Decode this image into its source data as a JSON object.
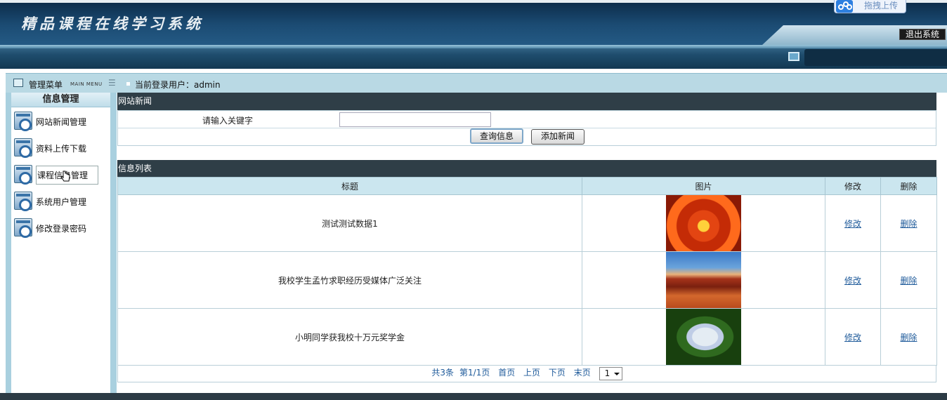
{
  "header": {
    "app_title": "精品课程在线学习系统",
    "upload_label": "拖拽上传",
    "logout_label": "退出系统"
  },
  "subbar": {
    "menu_title": "管理菜单",
    "menu_sub": "MAIN MENU",
    "user_label": "当前登录用户：",
    "user_name": "admin"
  },
  "sidebar": {
    "section": "信息管理",
    "items": [
      {
        "label": "网站新闻管理"
      },
      {
        "label": "资料上传下载"
      },
      {
        "label": "课程信息管理"
      },
      {
        "label": "系统用户管理"
      },
      {
        "label": "修改登录密码"
      }
    ]
  },
  "search": {
    "panel_title": "网站新闻",
    "keyword_label": "请输入关键字",
    "keyword_value": "",
    "query_button": "查询信息",
    "add_button": "添加新闻"
  },
  "list": {
    "panel_title": "信息列表",
    "columns": [
      "标题",
      "图片",
      "修改",
      "删除"
    ],
    "rows": [
      {
        "title": "测试测试数据1",
        "image": "flower1",
        "edit": "修改",
        "delete": "删除"
      },
      {
        "title": "我校学生孟竹求职经历受媒体广泛关注",
        "image": "desert",
        "edit": "修改",
        "delete": "删除"
      },
      {
        "title": "小明同学获我校十万元奖学金",
        "image": "hydrangea",
        "edit": "修改",
        "delete": "删除"
      }
    ],
    "pager": {
      "total": "共3条",
      "page_info": "第1/1页",
      "first": "首页",
      "prev": "上页",
      "next": "下页",
      "last": "末页",
      "page_select": "1"
    }
  }
}
